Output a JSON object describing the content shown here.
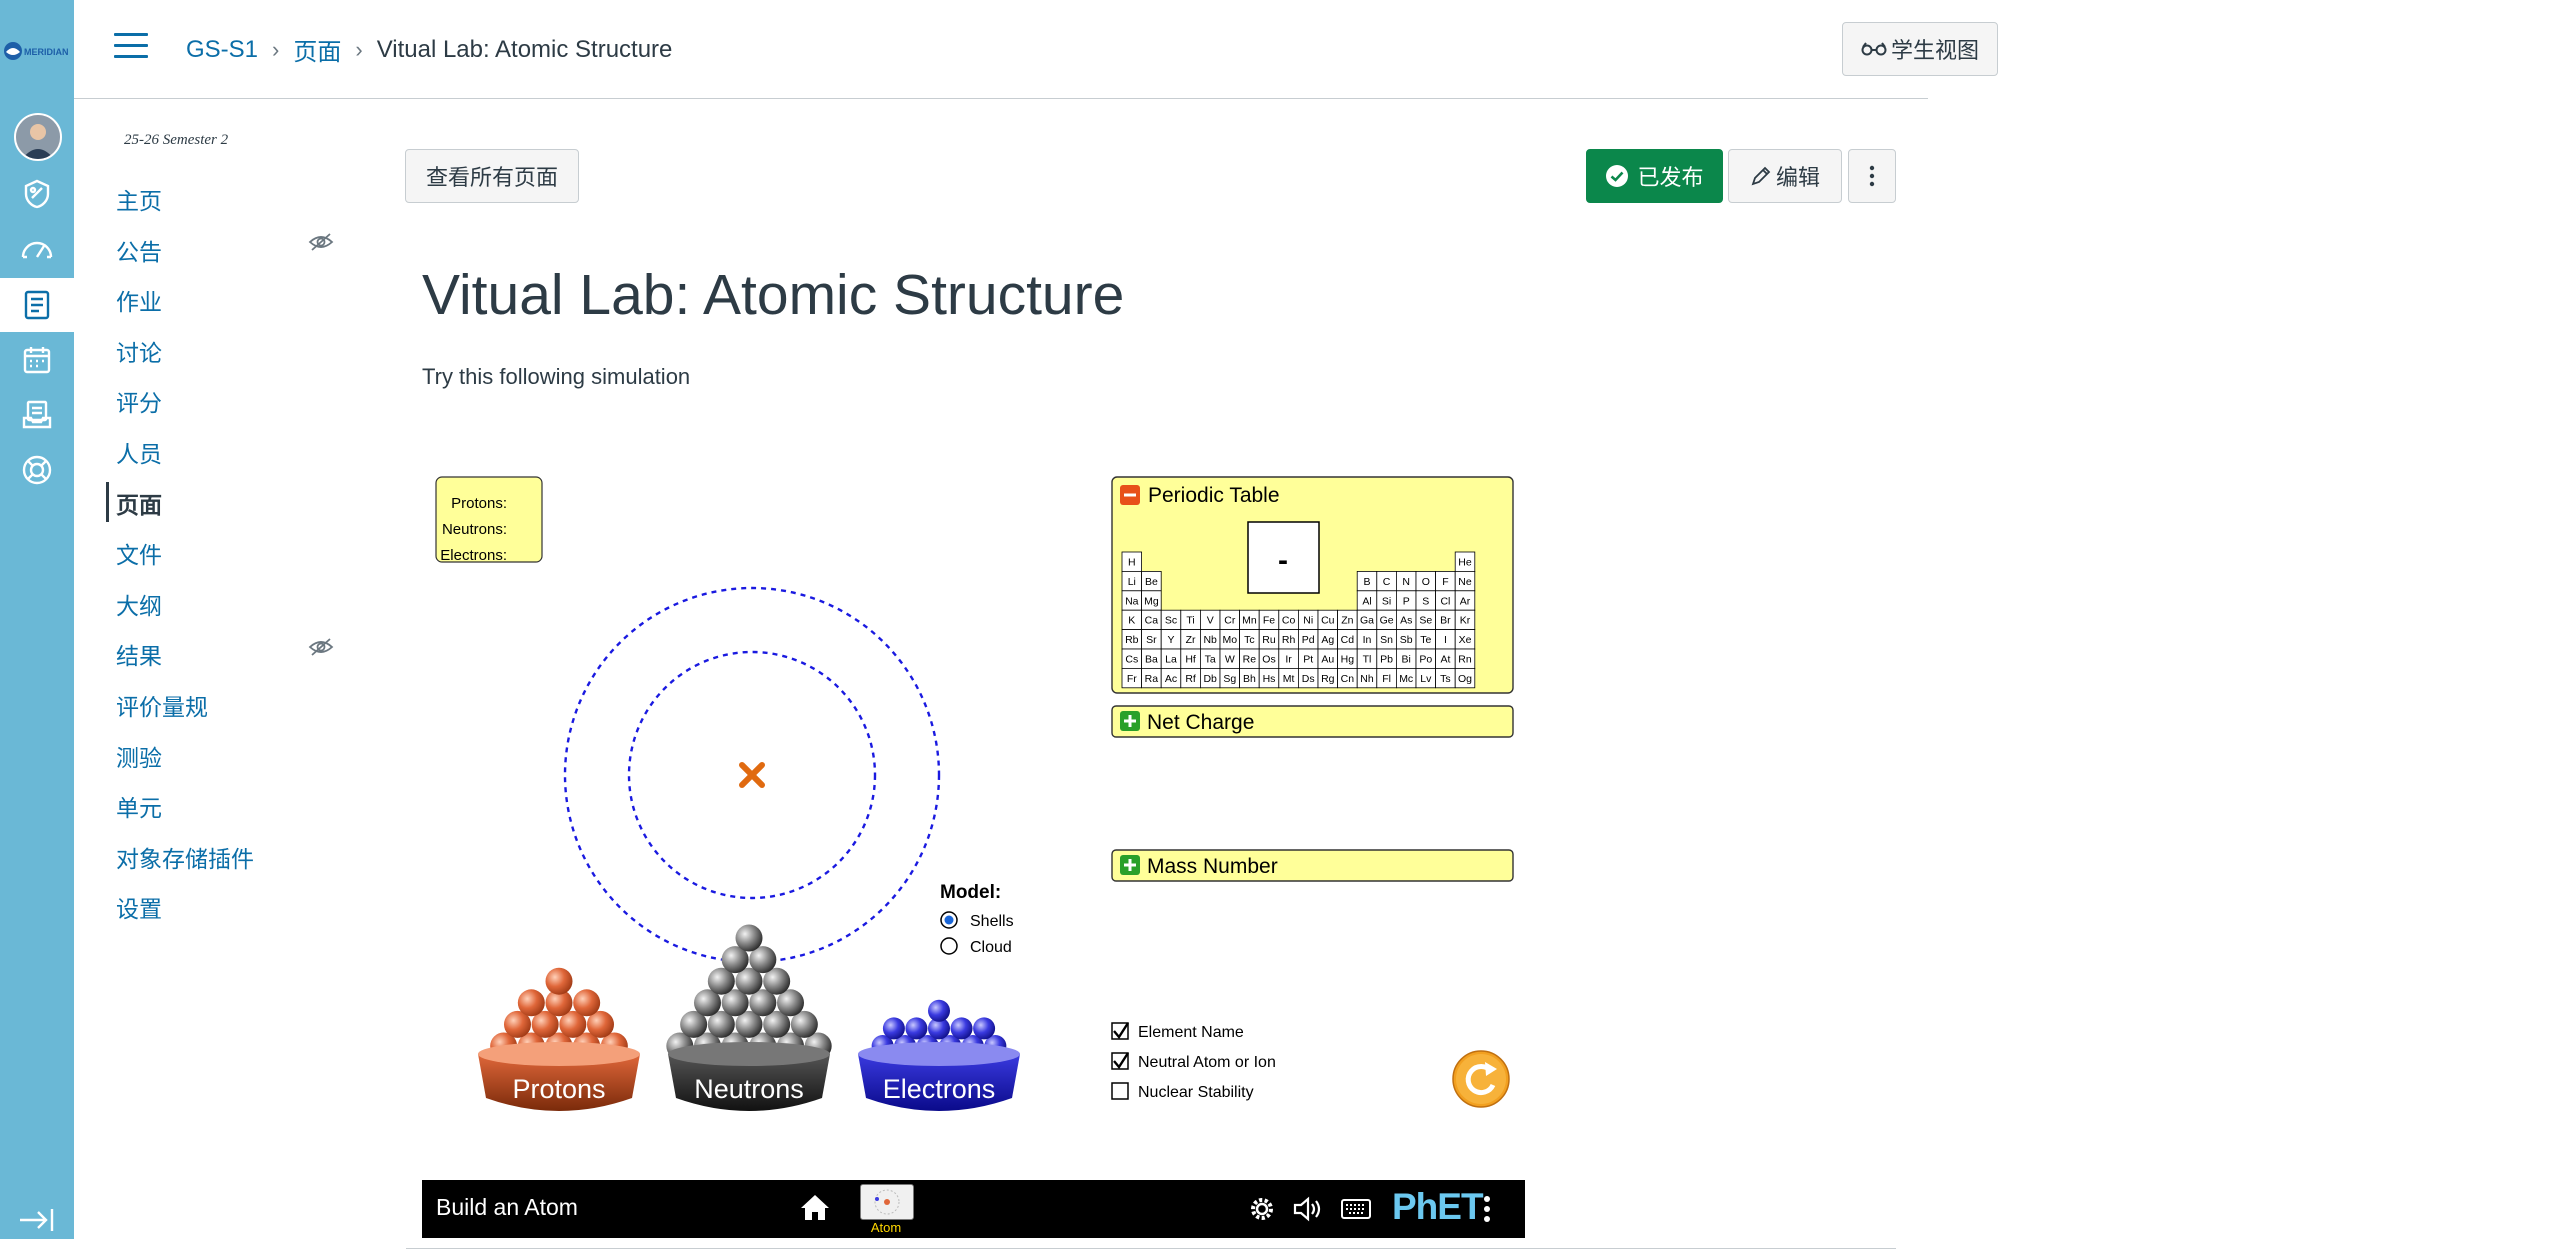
{
  "global_nav": {
    "logo_text": "MERIDIAN",
    "icons": [
      "account-avatar",
      "admin-icon",
      "dashboard-icon",
      "courses-icon",
      "calendar-icon",
      "inbox-icon",
      "help-icon",
      "collapse-nav-icon"
    ]
  },
  "header": {
    "breadcrumbs": [
      "GS-S1",
      "页面",
      "Vitual Lab: Atomic Structure"
    ],
    "student_view": "学生视图"
  },
  "course_nav": {
    "term": "25-26 Semester 2",
    "items": [
      {
        "label": "主页",
        "hidden": false
      },
      {
        "label": "公告",
        "hidden": true
      },
      {
        "label": "作业",
        "hidden": false
      },
      {
        "label": "讨论",
        "hidden": false
      },
      {
        "label": "评分",
        "hidden": false
      },
      {
        "label": "人员",
        "hidden": false
      },
      {
        "label": "页面",
        "hidden": false,
        "active": true
      },
      {
        "label": "文件",
        "hidden": false
      },
      {
        "label": "大纲",
        "hidden": false
      },
      {
        "label": "结果",
        "hidden": true
      },
      {
        "label": "评价量规",
        "hidden": false
      },
      {
        "label": "测验",
        "hidden": false
      },
      {
        "label": "单元",
        "hidden": false
      },
      {
        "label": "对象存储插件",
        "hidden": false
      },
      {
        "label": "设置",
        "hidden": false
      }
    ]
  },
  "page": {
    "view_all_pages": "查看所有页面",
    "published": "已发布",
    "edit": "编辑",
    "title": "Vitual Lab: Atomic Structure",
    "intro": "Try this following simulation"
  },
  "simulation": {
    "info_box": {
      "protons": "Protons:",
      "neutrons": "Neutrons:",
      "electrons": "Electrons:"
    },
    "model_label": "Model:",
    "model_options": [
      {
        "label": "Shells",
        "selected": true
      },
      {
        "label": "Cloud",
        "selected": false
      }
    ],
    "periodic_table_title": "Periodic Table",
    "element_symbol_display": "-",
    "periodic_rows": [
      [
        "H",
        "",
        "",
        "",
        "",
        "",
        "",
        "",
        "",
        "",
        "",
        "",
        "",
        "",
        "",
        "",
        "",
        "He"
      ],
      [
        "Li",
        "Be",
        "",
        "",
        "",
        "",
        "",
        "",
        "",
        "",
        "",
        "",
        "B",
        "C",
        "N",
        "O",
        "F",
        "Ne"
      ],
      [
        "Na",
        "Mg",
        "",
        "",
        "",
        "",
        "",
        "",
        "",
        "",
        "",
        "",
        "Al",
        "Si",
        "P",
        "S",
        "Cl",
        "Ar"
      ],
      [
        "K",
        "Ca",
        "Sc",
        "Ti",
        "V",
        "Cr",
        "Mn",
        "Fe",
        "Co",
        "Ni",
        "Cu",
        "Zn",
        "Ga",
        "Ge",
        "As",
        "Se",
        "Br",
        "Kr"
      ],
      [
        "Rb",
        "Sr",
        "Y",
        "Zr",
        "Nb",
        "Mo",
        "Tc",
        "Ru",
        "Rh",
        "Pd",
        "Ag",
        "Cd",
        "In",
        "Sn",
        "Sb",
        "Te",
        "I",
        "Xe"
      ],
      [
        "Cs",
        "Ba",
        "La",
        "Hf",
        "Ta",
        "W",
        "Re",
        "Os",
        "Ir",
        "Pt",
        "Au",
        "Hg",
        "Tl",
        "Pb",
        "Bi",
        "Po",
        "At",
        "Rn"
      ],
      [
        "Fr",
        "Ra",
        "Ac",
        "Rf",
        "Db",
        "Sg",
        "Bh",
        "Hs",
        "Mt",
        "Ds",
        "Rg",
        "Cn",
        "Nh",
        "Fl",
        "Mc",
        "Lv",
        "Ts",
        "Og"
      ]
    ],
    "net_charge_title": "Net Charge",
    "mass_number_title": "Mass Number",
    "buckets": [
      "Protons",
      "Neutrons",
      "Electrons"
    ],
    "checkboxes": [
      {
        "label": "Element Name",
        "checked": true
      },
      {
        "label": "Neutral Atom or Ion",
        "checked": true
      },
      {
        "label": "Nuclear Stability",
        "checked": false
      }
    ],
    "nav_bar": {
      "title": "Build an Atom",
      "screen_label": "Atom",
      "brand": "PhET"
    }
  },
  "colors": {
    "canvas_blue": "#0b6ea8",
    "published_green": "#0b874b",
    "global_nav_bg": "#6ab8d6",
    "panel_yellow": "#ffff99",
    "proton_orange": "#e0673a",
    "electron_blue": "#3a3ae0"
  }
}
